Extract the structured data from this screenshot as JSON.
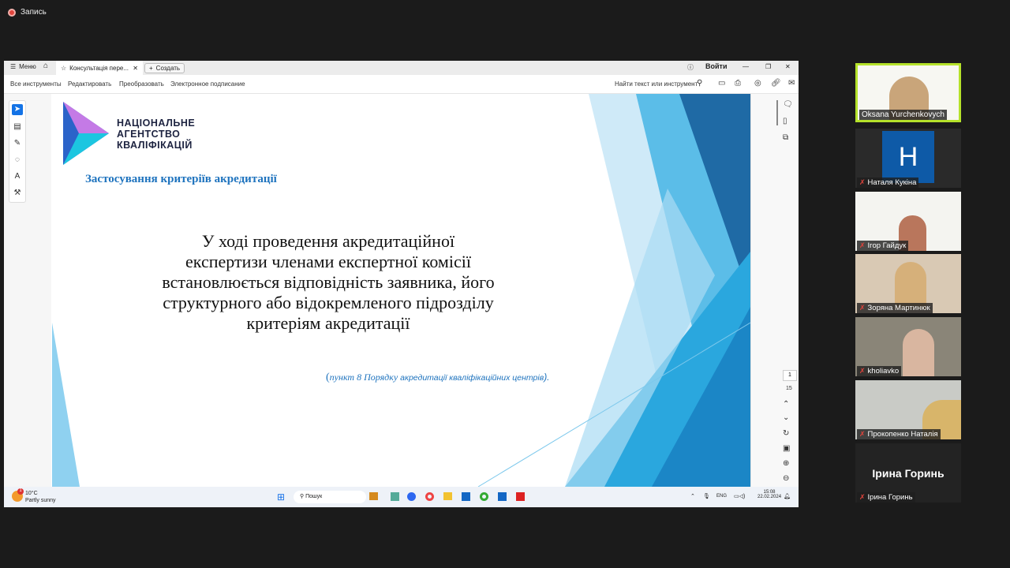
{
  "recording": {
    "label": "Запись"
  },
  "app": {
    "menu_label": "Меню",
    "tab_title": "Консультація пере...",
    "create_label": "Создать",
    "signin_label": "Войти",
    "toolbar": {
      "all_tools": "Все инструменты",
      "edit": "Редактировать",
      "convert": "Преобразовать",
      "esign": "Электронное подписание",
      "search": "Найти текст или инструмент"
    },
    "page": {
      "current": "1",
      "total": "15"
    }
  },
  "slide": {
    "logo_lines": [
      "НАЦІОНАЛЬНЕ",
      "АГЕНТСТВО",
      "КВАЛІФІКАЦІЙ"
    ],
    "heading": "Застосування критеріїв акредитації",
    "body_lines": [
      "У ході проведення акредитаційної",
      "експертизи членами експертної комісії",
      "встановлюється відповідність заявника, його",
      "структурного або відокремленого підрозділу",
      "критеріям акредитації"
    ],
    "citation_open": "(",
    "citation_a": "пункт 8 Порядку ",
    "citation_b": "акредитації кваліфікаційних центрів",
    "citation_close": ")."
  },
  "taskbar": {
    "temp": "10°C",
    "weather": "Partly sunny",
    "search": "Пошук",
    "lang": "ENG",
    "time": "15:08",
    "date": "22.02.2024",
    "badge": "1"
  },
  "participants": [
    {
      "name": "Oksana Yurchenkovych",
      "muted": false
    },
    {
      "name": "Наталя Кукіна",
      "muted": true,
      "initial": "H"
    },
    {
      "name": "Ігор Гайдук",
      "muted": true
    },
    {
      "name": "Зоряна Мартинюк",
      "muted": true
    },
    {
      "name": "kholiavko",
      "muted": true
    },
    {
      "name": "Прокопенко Наталія",
      "muted": true
    },
    {
      "name": "Ірина Горинь",
      "muted": true,
      "initial": "Ірина Горинь"
    }
  ]
}
